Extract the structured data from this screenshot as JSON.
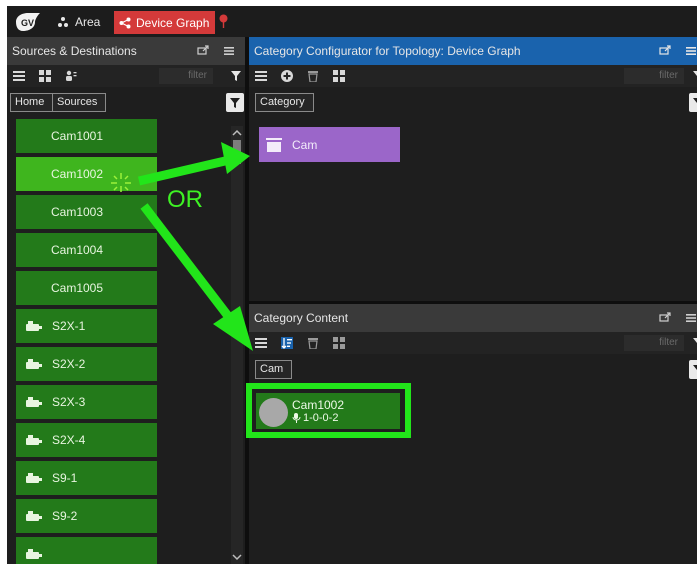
{
  "topbar": {
    "area_label": "Area",
    "device_graph_label": "Device Graph"
  },
  "sources_panel": {
    "title": "Sources & Destinations",
    "filter_placeholder": "filter",
    "breadcrumbs": [
      "Home",
      "Sources"
    ],
    "items": [
      {
        "label": "Cam1001",
        "kind": "cam",
        "selected": false
      },
      {
        "label": "Cam1002",
        "kind": "cam",
        "selected": true
      },
      {
        "label": "Cam1003",
        "kind": "cam",
        "selected": false
      },
      {
        "label": "Cam1004",
        "kind": "cam",
        "selected": false
      },
      {
        "label": "Cam1005",
        "kind": "cam",
        "selected": false
      },
      {
        "label": "S2X-1",
        "kind": "device",
        "selected": false
      },
      {
        "label": "S2X-2",
        "kind": "device",
        "selected": false
      },
      {
        "label": "S2X-3",
        "kind": "device",
        "selected": false
      },
      {
        "label": "S2X-4",
        "kind": "device",
        "selected": false
      },
      {
        "label": "S9-1",
        "kind": "device",
        "selected": false
      },
      {
        "label": "S9-2",
        "kind": "device",
        "selected": false
      },
      {
        "label": "",
        "kind": "device",
        "selected": false
      }
    ]
  },
  "configurator_panel": {
    "title": "Category Configurator for Topology: Device Graph",
    "filter_placeholder": "filter",
    "breadcrumb": "Category",
    "category_tile": {
      "label": "Cam"
    }
  },
  "content_panel": {
    "title": "Category Content",
    "filter_placeholder": "filter",
    "breadcrumb": "Cam",
    "tile": {
      "name": "Cam1002",
      "address": "1-0-0-2"
    }
  },
  "annotation": {
    "or_text": "OR",
    "arrow_color": "#22e51a"
  },
  "colors": {
    "accent_blue": "#1a63ad",
    "item_green": "#237a1a",
    "selected_green": "#3fb51e",
    "category_purple": "#9b66c9",
    "device_graph_red": "#d43a3a"
  }
}
